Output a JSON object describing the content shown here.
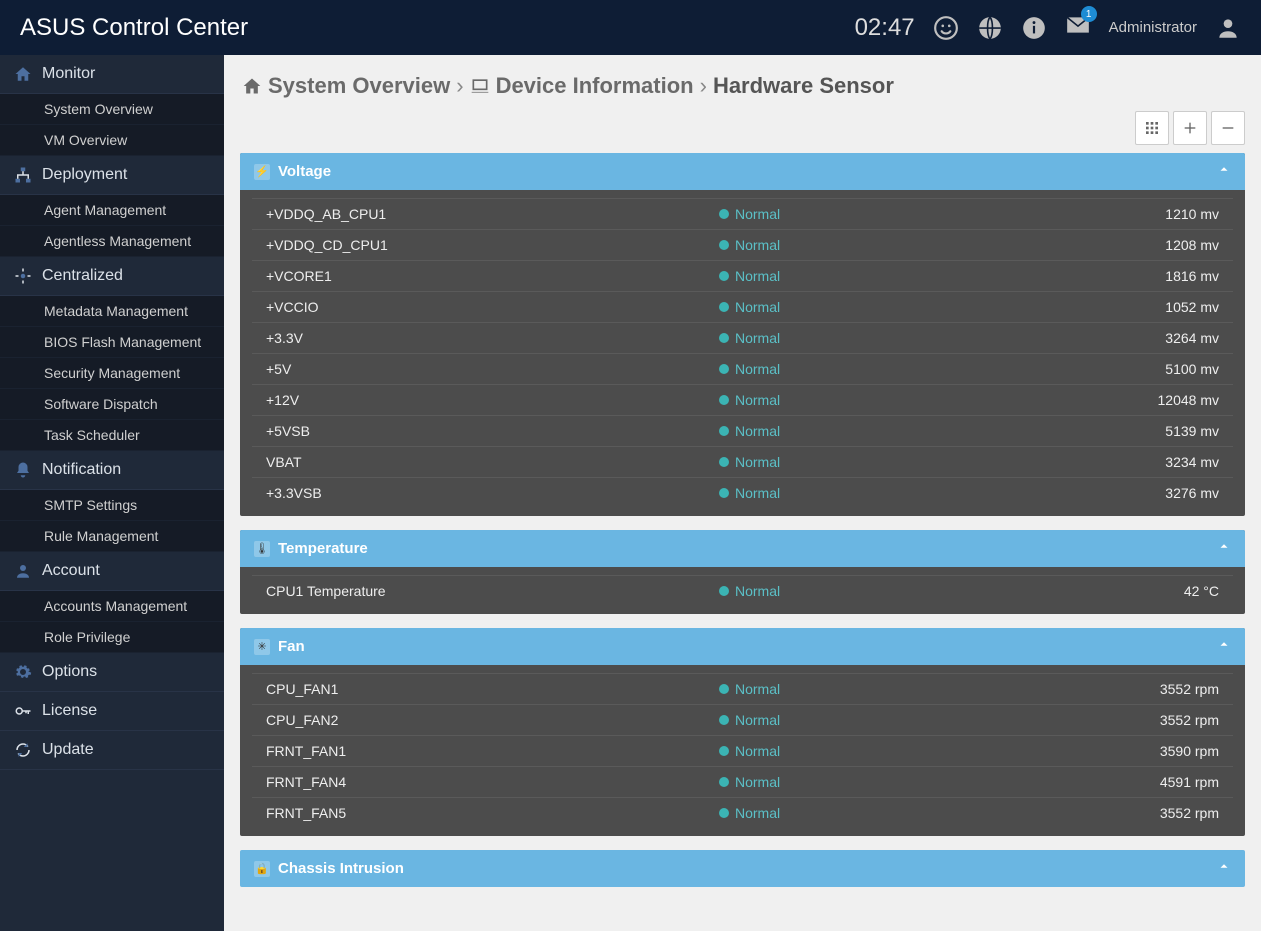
{
  "app": {
    "title_bold": "ASUS",
    "title_rest": "Control Center"
  },
  "header": {
    "clock": "02:47",
    "notif_count": "1",
    "user": "Administrator"
  },
  "sidebar": [
    {
      "icon": "home",
      "label": "Monitor",
      "items": [
        {
          "label": "System Overview"
        },
        {
          "label": "VM Overview"
        }
      ]
    },
    {
      "icon": "sitemap",
      "label": "Deployment",
      "items": [
        {
          "label": "Agent Management"
        },
        {
          "label": "Agentless Management"
        }
      ]
    },
    {
      "icon": "target",
      "label": "Centralized",
      "items": [
        {
          "label": "Metadata Management"
        },
        {
          "label": "BIOS Flash Management"
        },
        {
          "label": "Security Management"
        },
        {
          "label": "Software Dispatch"
        },
        {
          "label": "Task Scheduler"
        }
      ]
    },
    {
      "icon": "bell",
      "label": "Notification",
      "items": [
        {
          "label": "SMTP Settings"
        },
        {
          "label": "Rule Management"
        }
      ]
    },
    {
      "icon": "user",
      "label": "Account",
      "items": [
        {
          "label": "Accounts Management"
        },
        {
          "label": "Role Privilege"
        }
      ]
    },
    {
      "icon": "gear",
      "label": "Options",
      "items": []
    },
    {
      "icon": "key",
      "label": "License",
      "items": []
    },
    {
      "icon": "refresh",
      "label": "Update",
      "items": []
    }
  ],
  "breadcrumb": {
    "root": "System Overview",
    "mid": "Device Information",
    "leaf": "Hardware Sensor"
  },
  "panels": [
    {
      "title": "Voltage",
      "icon": "⚡",
      "rows": [
        {
          "name": "+VDDQ_AB_CPU1",
          "status": "Normal",
          "value": "1210 mv"
        },
        {
          "name": "+VDDQ_CD_CPU1",
          "status": "Normal",
          "value": "1208 mv"
        },
        {
          "name": "+VCORE1",
          "status": "Normal",
          "value": "1816 mv"
        },
        {
          "name": "+VCCIO",
          "status": "Normal",
          "value": "1052 mv"
        },
        {
          "name": "+3.3V",
          "status": "Normal",
          "value": "3264 mv"
        },
        {
          "name": "+5V",
          "status": "Normal",
          "value": "5100 mv"
        },
        {
          "name": "+12V",
          "status": "Normal",
          "value": "12048 mv"
        },
        {
          "name": "+5VSB",
          "status": "Normal",
          "value": "5139 mv"
        },
        {
          "name": "VBAT",
          "status": "Normal",
          "value": "3234 mv"
        },
        {
          "name": "+3.3VSB",
          "status": "Normal",
          "value": "3276 mv"
        }
      ]
    },
    {
      "title": "Temperature",
      "icon": "🌡",
      "rows": [
        {
          "name": "CPU1 Temperature",
          "status": "Normal",
          "value": "42 °C"
        }
      ]
    },
    {
      "title": "Fan",
      "icon": "✳",
      "rows": [
        {
          "name": "CPU_FAN1",
          "status": "Normal",
          "value": "3552 rpm"
        },
        {
          "name": "CPU_FAN2",
          "status": "Normal",
          "value": "3552 rpm"
        },
        {
          "name": "FRNT_FAN1",
          "status": "Normal",
          "value": "3590 rpm"
        },
        {
          "name": "FRNT_FAN4",
          "status": "Normal",
          "value": "4591 rpm"
        },
        {
          "name": "FRNT_FAN5",
          "status": "Normal",
          "value": "3552 rpm"
        }
      ]
    },
    {
      "title": "Chassis Intrusion",
      "icon": "🔒",
      "rows": []
    }
  ]
}
